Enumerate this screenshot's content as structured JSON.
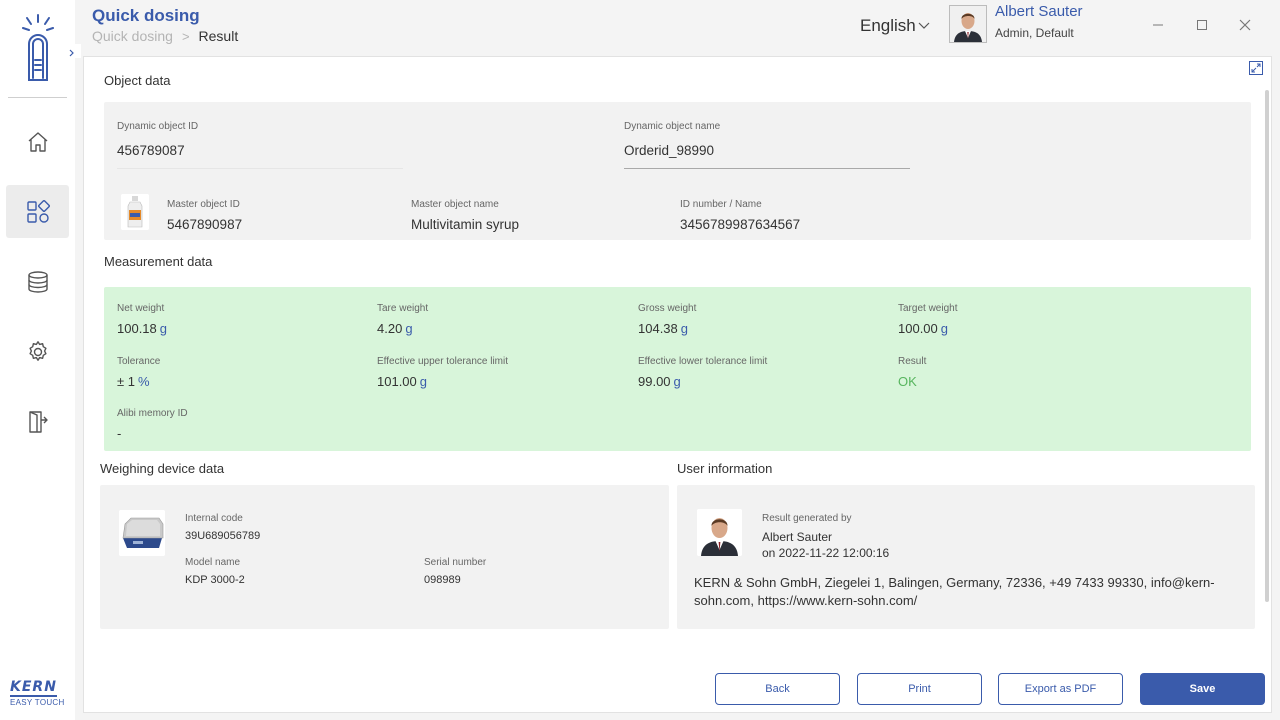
{
  "header": {
    "title": "Quick dosing",
    "breadcrumb": [
      "Quick dosing",
      "Result"
    ],
    "language": "English",
    "user": {
      "name": "Albert Sauter",
      "role": "Admin, Default"
    }
  },
  "sidebar": {
    "items": [
      {
        "name": "home",
        "icon": "home-icon"
      },
      {
        "name": "apps",
        "icon": "apps-grid-icon",
        "active": true
      },
      {
        "name": "database",
        "icon": "database-icon"
      },
      {
        "name": "settings",
        "icon": "gear-icon"
      },
      {
        "name": "logout",
        "icon": "exit-icon"
      }
    ],
    "brand": "KERN",
    "brand_sub": "EASY TOUCH"
  },
  "object_data": {
    "title": "Object data",
    "dynamic_id_label": "Dynamic object ID",
    "dynamic_id": "456789087",
    "dynamic_name_label": "Dynamic object name",
    "dynamic_name": "Orderid_98990",
    "master_id_label": "Master object ID",
    "master_id": "5467890987",
    "master_name_label": "Master object name",
    "master_name": "Multivitamin syrup",
    "id_number_label": "ID number / Name",
    "id_number": "3456789987634567"
  },
  "measurement_data": {
    "title": "Measurement data",
    "net_weight": {
      "label": "Net weight",
      "value": "100.18",
      "unit": "g"
    },
    "tare_weight": {
      "label": "Tare weight",
      "value": "4.20",
      "unit": "g"
    },
    "gross_weight": {
      "label": "Gross weight",
      "value": "104.38",
      "unit": "g"
    },
    "target_weight": {
      "label": "Target weight",
      "value": "100.00",
      "unit": "g"
    },
    "tolerance": {
      "label": "Tolerance",
      "value": "± 1",
      "unit": "%"
    },
    "upper_limit": {
      "label": "Effective upper tolerance limit",
      "value": "101.00",
      "unit": "g"
    },
    "lower_limit": {
      "label": "Effective lower tolerance limit",
      "value": "99.00",
      "unit": "g"
    },
    "result": {
      "label": "Result",
      "value": "OK"
    },
    "alibi": {
      "label": "Alibi memory ID",
      "value": "-"
    }
  },
  "device_data": {
    "title": "Weighing device data",
    "internal_code_label": "Internal code",
    "internal_code": "39U689056789",
    "model_label": "Model name",
    "model": "KDP 3000-2",
    "serial_label": "Serial number",
    "serial": "098989"
  },
  "user_info": {
    "title": "User information",
    "generated_label": "Result generated by",
    "generated_by": "Albert Sauter",
    "generated_on": "on 2022-11-22 12:00:16",
    "contact": "KERN & Sohn GmbH, Ziegelei 1, Balingen, Germany, 72336, +49 7433 99330, info@kern-sohn.com, https://www.kern-sohn.com/"
  },
  "buttons": {
    "back": "Back",
    "print": "Print",
    "export": "Export as PDF",
    "save": "Save"
  },
  "colors": {
    "accent": "#3a5bab",
    "ok": "#57b55e",
    "measurement_bg": "#d8f5da"
  }
}
